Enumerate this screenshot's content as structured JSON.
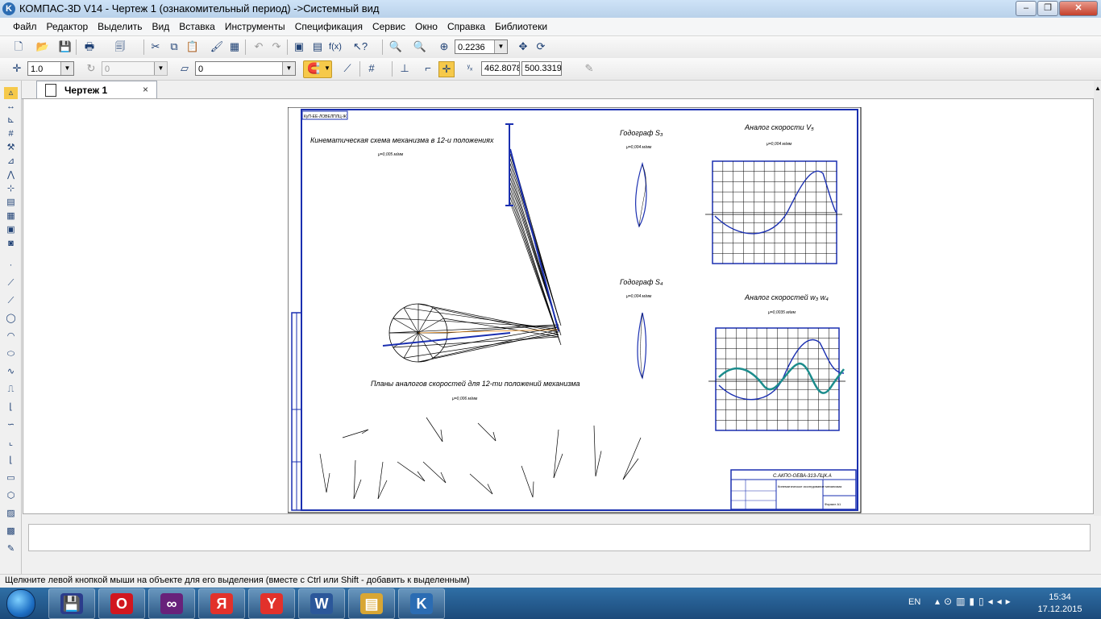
{
  "window": {
    "title": "КОМПАС-3D V14 - Чертеж 1 (ознакомительный период) ->Системный вид",
    "app_icon_letter": "K"
  },
  "menu": [
    "Файл",
    "Редактор",
    "Выделить",
    "Вид",
    "Вставка",
    "Инструменты",
    "Спецификация",
    "Сервис",
    "Окно",
    "Справка",
    "Библиотеки"
  ],
  "toolbar_standard": {
    "zoom_value": "0.2236"
  },
  "toolbar_current_state": {
    "step_value": "1.0",
    "angle_value": "0",
    "layer_value": "0",
    "coord_x": "462.8078",
    "coord_y": "500.3319",
    "x_label": "x",
    "y_label": "y"
  },
  "document_tab": {
    "label": "Чертеж 1",
    "close": "×"
  },
  "drawing": {
    "corner_stamp": "КуП-ЕЕ-ЛОВЕЛПЛЦ-Ж",
    "title_mechanism": "Кинематическая схема механизма в 12-и положениях",
    "scale_mechanism": "μ=0,005 м/мм",
    "title_hodograph_s3": "Годограф S₃",
    "scale_hodograph_s3": "μ=0,004 м/мм",
    "title_velocity_v": "Аналог скорости V₅",
    "scale_velocity_v": "μ=0,004 м/мм",
    "title_hodograph_s4": "Годограф S₄",
    "scale_hodograph_s4": "μ=0,004 м/мм",
    "title_velocity_w": "Аналог скоростей w₃ w₄",
    "scale_velocity_w": "μ=0,0035 м/мм",
    "title_velocity_plans": "Планы аналогов скоростей для 12-ти положений механизма",
    "scale_velocity_plans": "μ=0,006 м/мм",
    "stamp_code": "С.АКПО-ОЕВА-313-ЛЦК.А",
    "stamp_name": "Кинематическое исследование механизма",
    "stamp_sheet": "Формат А1"
  },
  "status": {
    "message": "Щелкните левой кнопкой мыши на объекте для его выделения (вместе с Ctrl или Shift - добавить к выделенным)"
  },
  "taskbar": {
    "items": [
      {
        "name": "save-app",
        "glyph": "💾",
        "color": "#2b3c8c"
      },
      {
        "name": "opera",
        "glyph": "O",
        "color": "#d1161f"
      },
      {
        "name": "visual-studio",
        "glyph": "∞",
        "color": "#68217a"
      },
      {
        "name": "yandex-browser",
        "glyph": "Я",
        "color": "#e2312b"
      },
      {
        "name": "yandex",
        "glyph": "Y",
        "color": "#e2312b"
      },
      {
        "name": "word",
        "glyph": "W",
        "color": "#2b579a"
      },
      {
        "name": "explorer",
        "glyph": "▤",
        "color": "#d8a634"
      },
      {
        "name": "kompas",
        "glyph": "K",
        "color": "#2b6cb3"
      }
    ],
    "language": "EN",
    "time": "15:34",
    "date": "17.12.2015"
  },
  "colors": {
    "accent_blue": "#1a2fb0",
    "teal": "#1c8c8c",
    "frame": "#1a2fb0"
  }
}
